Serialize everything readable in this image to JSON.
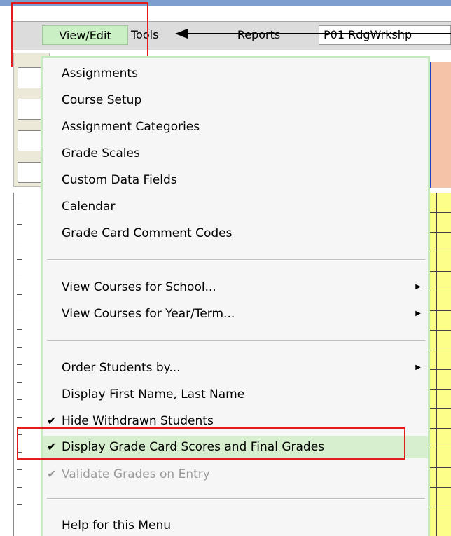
{
  "menubar": {
    "view_edit": "View/Edit",
    "tools": "Tools",
    "reports": "Reports",
    "course": "P01  RdgWrkshp"
  },
  "dropdown": {
    "items": [
      {
        "label": "Assignments"
      },
      {
        "label": "Course Setup"
      },
      {
        "label": "Assignment Categories"
      },
      {
        "label": "Grade Scales"
      },
      {
        "label": "Custom Data Fields"
      },
      {
        "label": "Calendar"
      },
      {
        "label": "Grade Card Comment Codes"
      },
      {
        "label": "View Courses for School..."
      },
      {
        "label": "View Courses for Year/Term..."
      },
      {
        "label": "Order Students by..."
      },
      {
        "label": "Display First Name, Last Name"
      },
      {
        "label": "Hide Withdrawn Students"
      },
      {
        "label": "Display Grade Card Scores and Final Grades"
      },
      {
        "label": "Validate Grades on Entry"
      },
      {
        "label": "Help for this Menu"
      }
    ],
    "check": "✔",
    "submenu": "▶"
  },
  "colors": {
    "menu_active": "#cbefc4",
    "highlight_red": "#e11c1c",
    "hover_item": "#d7eecf"
  }
}
